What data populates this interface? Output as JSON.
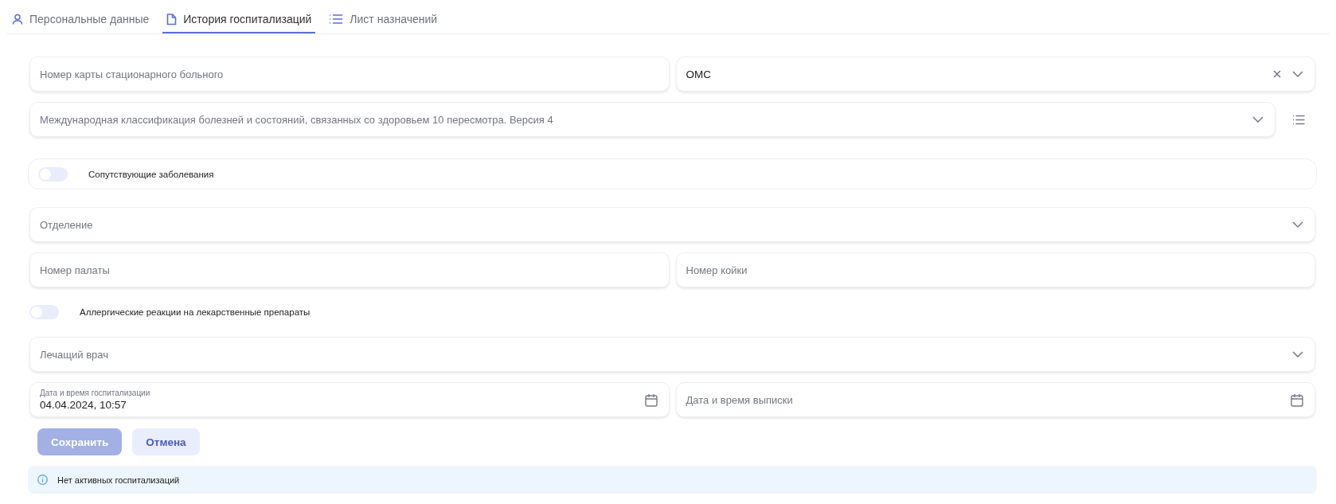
{
  "tabs": [
    {
      "label": "Персональные данные",
      "selected": false
    },
    {
      "label": "История госпитализаций",
      "selected": true
    },
    {
      "label": "Лист назначений",
      "selected": false
    }
  ],
  "form": [
    {
      "kind": "row",
      "fields": [
        {
          "kind": "text",
          "placeholder": "Номер карты стационарного больного"
        },
        {
          "kind": "select",
          "value": "ОМС",
          "clearable": true
        }
      ]
    },
    {
      "kind": "row",
      "list_button": true,
      "fields": [
        {
          "kind": "select",
          "placeholder": "Международная классификация болезней и состояний, связанных со здоровьем 10 пересмотра. Версия 4",
          "clearable": false
        }
      ]
    },
    {
      "kind": "toggle",
      "framed": true,
      "label": "Сопутствующие заболевания",
      "on": false
    },
    {
      "kind": "row",
      "fields": [
        {
          "kind": "select",
          "placeholder": "Отделение",
          "clearable": false
        }
      ]
    },
    {
      "kind": "row",
      "fields": [
        {
          "kind": "text",
          "placeholder": "Номер палаты"
        },
        {
          "kind": "text",
          "placeholder": "Номер койки"
        }
      ]
    },
    {
      "kind": "toggle",
      "framed": false,
      "label": "Аллергические реакции на лекарственные препараты",
      "on": false
    },
    {
      "kind": "row",
      "fields": [
        {
          "kind": "select",
          "placeholder": "Лечащий врач",
          "clearable": false
        }
      ]
    },
    {
      "kind": "row",
      "fields": [
        {
          "kind": "date",
          "label": "Дата и время госпитализации",
          "value": "04.04.2024, 10:57"
        },
        {
          "kind": "date",
          "placeholder": "Дата и время выписки"
        }
      ]
    }
  ],
  "actions": [
    {
      "label": "Сохранить",
      "kind": "primary",
      "disabled": true
    },
    {
      "label": "Отмена",
      "kind": "secondary",
      "disabled": false
    }
  ],
  "info": {
    "text": "Нет активных госпитализаций"
  }
}
